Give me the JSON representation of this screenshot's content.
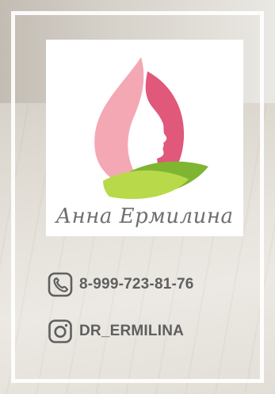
{
  "logo": {
    "name_signature": "Анна Ермилина",
    "colors": {
      "petal_light": "#f4a8b4",
      "petal_dark": "#e0587a",
      "leaf_light": "#b8d94a",
      "leaf_dark": "#7fb533"
    }
  },
  "contacts": {
    "phone": {
      "icon": "phone-icon",
      "text": "8-999-723-81-76"
    },
    "instagram": {
      "icon": "instagram-icon",
      "text": "DR_ERMILINA"
    }
  },
  "colors": {
    "text": "#5f5f5f",
    "frame": "#ffffff"
  }
}
